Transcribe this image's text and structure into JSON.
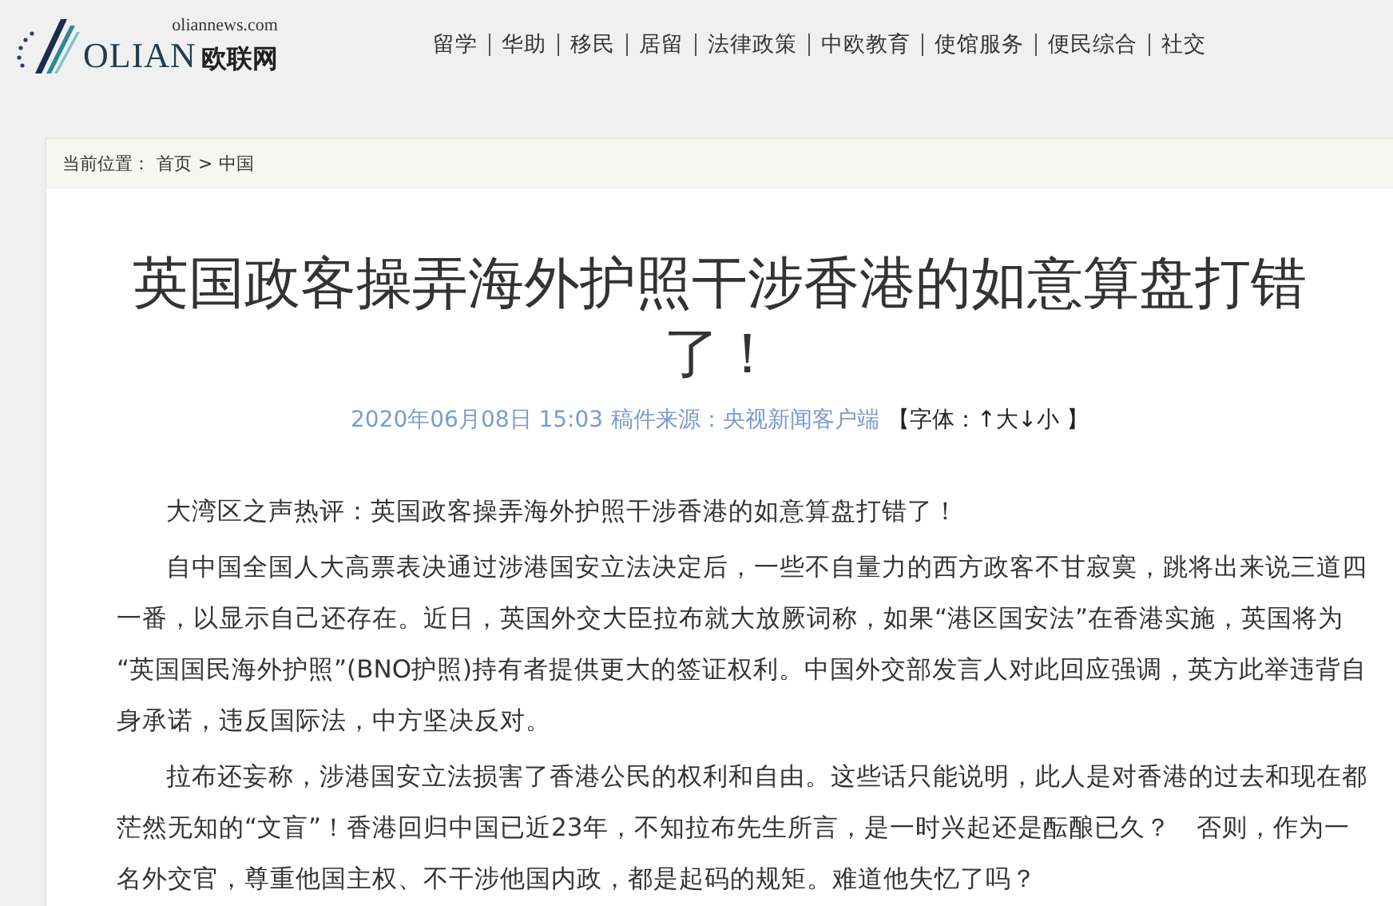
{
  "logo": {
    "domain": "oliannews.com",
    "wordmark": "OLIAN",
    "name_cn": "欧联网"
  },
  "nav": [
    "留学",
    "华助",
    "移民",
    "居留",
    "法律政策",
    "中欧教育",
    "使馆服务",
    "便民综合",
    "社交"
  ],
  "breadcrumb": {
    "label": "当前位置：",
    "home": "首页",
    "separator": ">",
    "current": "中国"
  },
  "article": {
    "title": "英国政客操弄海外护照干涉香港的如意算盘打错了！",
    "date": "2020年06月08日 15:03",
    "source": "稿件来源：央视新闻客户端",
    "font_tools": {
      "open": "【字体：",
      "larger": "↑大",
      "smaller": "↓小",
      "close": " 】"
    },
    "paragraphs": [
      "大湾区之声热评：英国政客操弄海外护照干涉香港的如意算盘打错了！",
      "自中国全国人大高票表决通过涉港国安立法决定后，一些不自量力的西方政客不甘寂寞，跳将出来说三道四一番，以显示自己还存在。近日，英国外交大臣拉布就大放厥词称，如果“港区国安法”在香港实施，英国将为 “英国国民海外护照”(BNO护照)持有者提供更大的签证权利。中国外交部发言人对此回应强调，英方此举违背自身承诺，违反国际法，中方坚决反对。",
      "拉布还妄称，涉港国安立法损害了香港公民的权利和自由。这些话只能说明，此人是对香港的过去和现在都茫然无知的“文盲”！香港回归中国已近23年，不知拉布先生所言，是一时兴起还是酝酿已久？　否则，作为一名外交官，尊重他国主权、不干涉他国内政，都是起码的规矩。难道他失忆了吗？"
    ]
  }
}
